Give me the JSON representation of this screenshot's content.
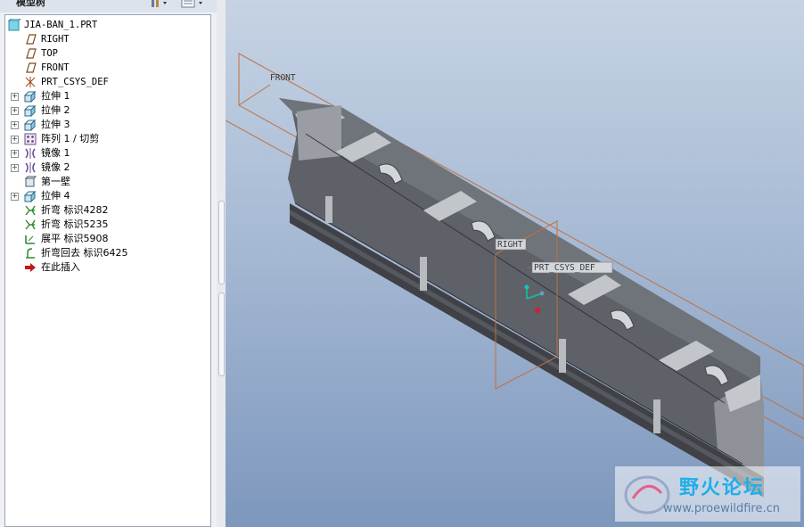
{
  "model_tree": {
    "title": "模型树",
    "root": "JIA-BAN_1.PRT",
    "items": [
      {
        "label": "RIGHT",
        "icon": "datum-plane-icon",
        "expandable": false
      },
      {
        "label": "TOP",
        "icon": "datum-plane-icon",
        "expandable": false
      },
      {
        "label": "FRONT",
        "icon": "datum-plane-icon",
        "expandable": false
      },
      {
        "label": "PRT_CSYS_DEF",
        "icon": "coordinate-system-icon",
        "expandable": false
      },
      {
        "label": "拉伸 1",
        "icon": "extrude-icon",
        "expandable": true
      },
      {
        "label": "拉伸 2",
        "icon": "extrude-icon",
        "expandable": true
      },
      {
        "label": "拉伸 3",
        "icon": "extrude-icon",
        "expandable": true
      },
      {
        "label": "阵列 1 / 切剪",
        "icon": "pattern-icon",
        "expandable": true
      },
      {
        "label": "镜像 1",
        "icon": "mirror-icon",
        "expandable": true
      },
      {
        "label": "镜像 2",
        "icon": "mirror-icon",
        "expandable": true
      },
      {
        "label": "第一壁",
        "icon": "first-wall-icon",
        "expandable": false
      },
      {
        "label": "拉伸 4",
        "icon": "extrude-icon",
        "expandable": true
      },
      {
        "label": "折弯  标识4282",
        "icon": "bend-icon",
        "expandable": false
      },
      {
        "label": "折弯  标识5235",
        "icon": "bend-icon",
        "expandable": false
      },
      {
        "label": "展平  标识5908",
        "icon": "unbend-icon",
        "expandable": false
      },
      {
        "label": "折弯回去  标识6425",
        "icon": "bend-back-icon",
        "expandable": false
      },
      {
        "label": "在此插入",
        "icon": "insert-here-arrow-icon",
        "expandable": false
      }
    ]
  },
  "viewport": {
    "datum_tags": {
      "front": "FRONT",
      "right": "RIGHT",
      "csys": "PRT_CSYS_DEF"
    }
  },
  "watermark": {
    "title": "野火论坛",
    "url": "www.proewildfire.cn"
  },
  "colors": {
    "background_top": "#c6d3e4",
    "background_bottom": "#7d97bd",
    "datum": "#c07040",
    "part": "#5e6168"
  }
}
